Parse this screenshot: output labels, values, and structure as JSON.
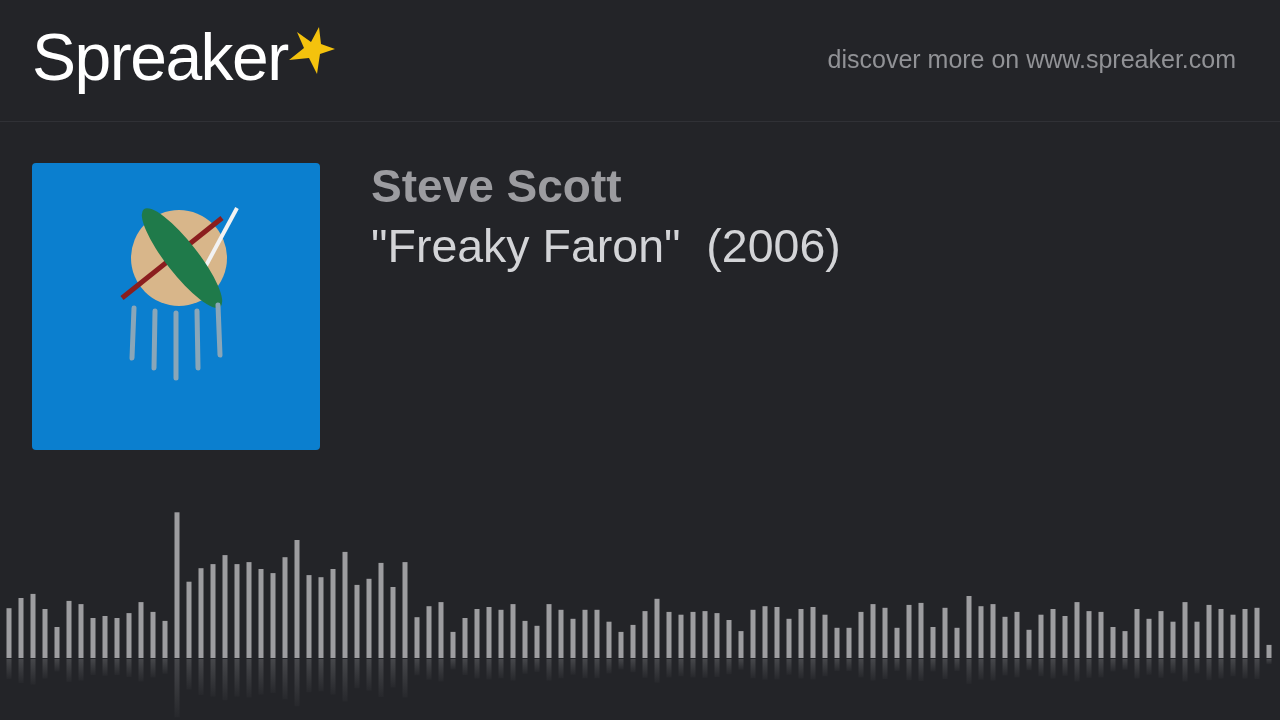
{
  "header": {
    "logo": {
      "text": "Spreaker"
    },
    "tagline": "discover more on www.spreaker.com"
  },
  "episode": {
    "author": "Steve Scott",
    "title": "\"Freaky Faron\"  (2006)"
  }
}
